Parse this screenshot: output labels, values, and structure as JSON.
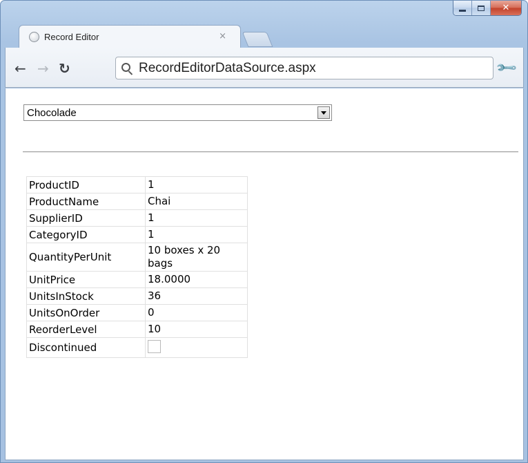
{
  "browser": {
    "tab_title": "Record Editor",
    "tab_close": "×",
    "url": "RecordEditorDataSource.aspx"
  },
  "page": {
    "product_select": {
      "selected": "Chocolade"
    },
    "details": {
      "rows": [
        {
          "field": "ProductID",
          "value": "1"
        },
        {
          "field": "ProductName",
          "value": "Chai"
        },
        {
          "field": "SupplierID",
          "value": "1"
        },
        {
          "field": "CategoryID",
          "value": "1"
        },
        {
          "field": "QuantityPerUnit",
          "value": "10 boxes x 20 bags"
        },
        {
          "field": "UnitPrice",
          "value": "18.0000"
        },
        {
          "field": "UnitsInStock",
          "value": "36"
        },
        {
          "field": "UnitsOnOrder",
          "value": "0"
        },
        {
          "field": "ReorderLevel",
          "value": "10"
        },
        {
          "field": "Discontinued",
          "checked": false
        }
      ]
    }
  },
  "icons": {
    "back": "back-arrow-icon",
    "forward": "forward-arrow-icon",
    "reload": "reload-icon",
    "search": "search-icon",
    "wrench": "wrench-icon",
    "globe": "globe-icon"
  }
}
